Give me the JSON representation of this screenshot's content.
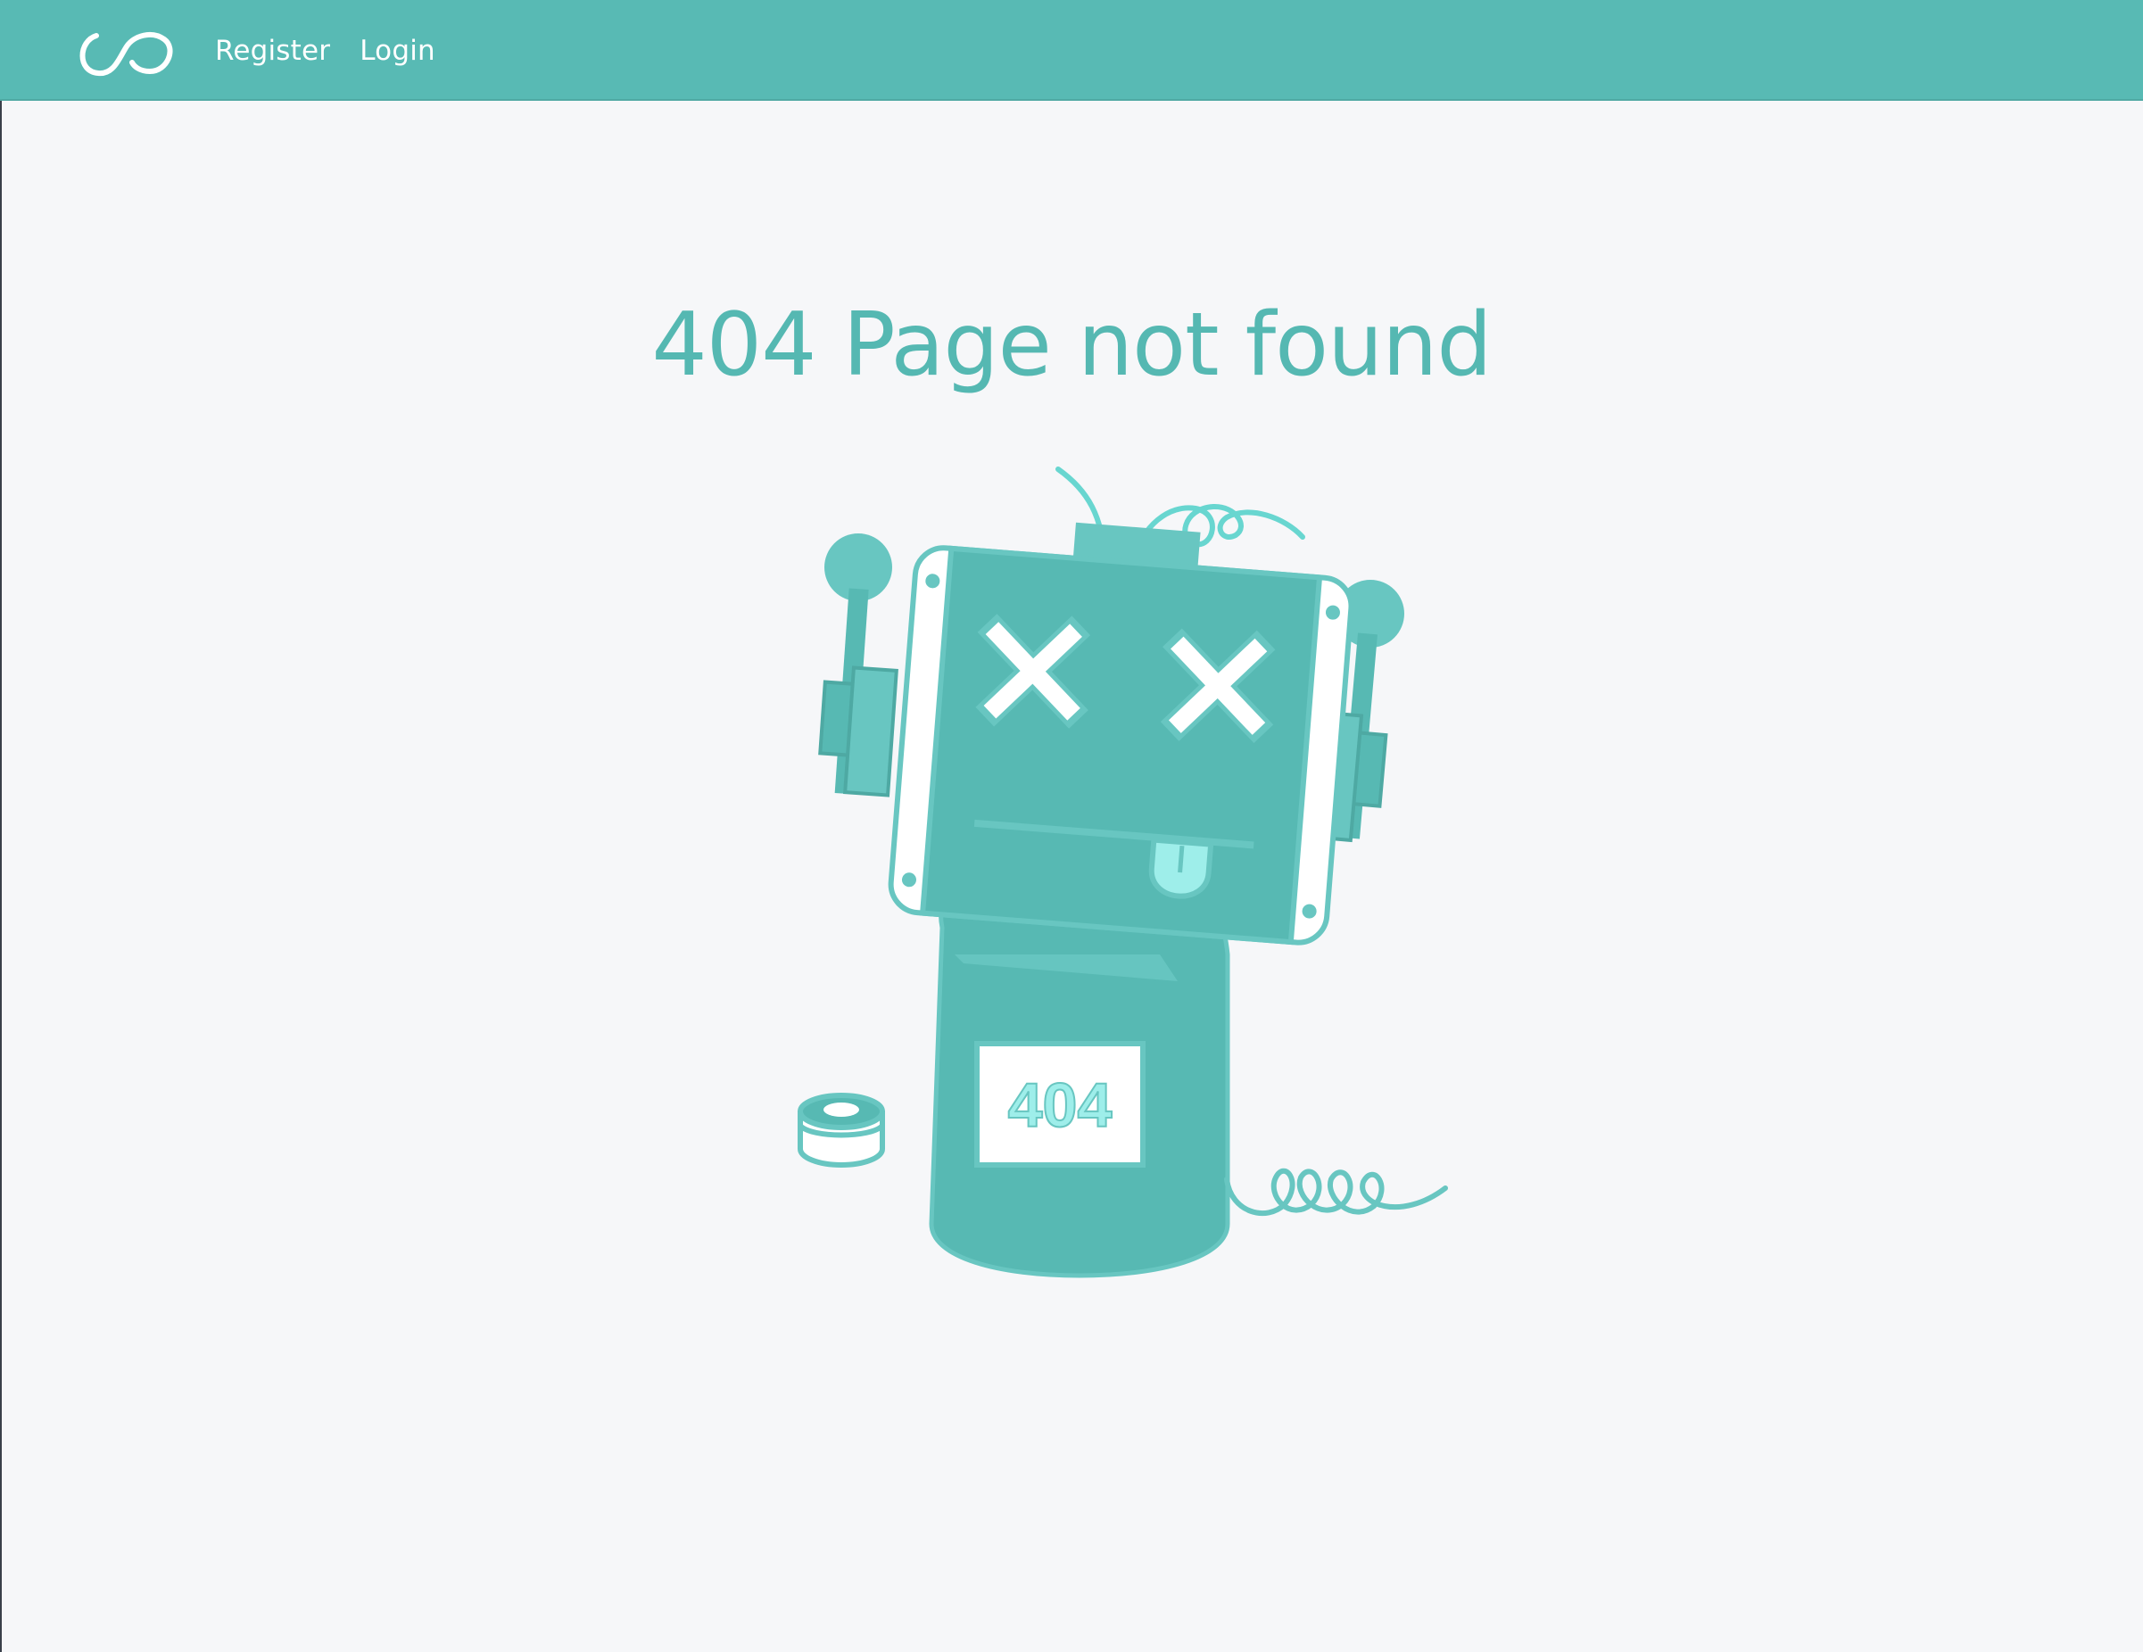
{
  "nav": {
    "logo_icon": "infinity-loop-logo",
    "links": [
      {
        "label": "Register"
      },
      {
        "label": "Login"
      }
    ]
  },
  "main": {
    "title": "404 Page not found",
    "illustration": {
      "icon": "broken-robot-illustration",
      "badge_text": "404"
    }
  },
  "colors": {
    "navbar": "#58bab4",
    "accent": "#55b8b2",
    "robot_dark": "#57b9b3",
    "robot_light": "#68c6c1",
    "robot_highlight": "#9eeeea",
    "background": "#f6f7f9"
  }
}
